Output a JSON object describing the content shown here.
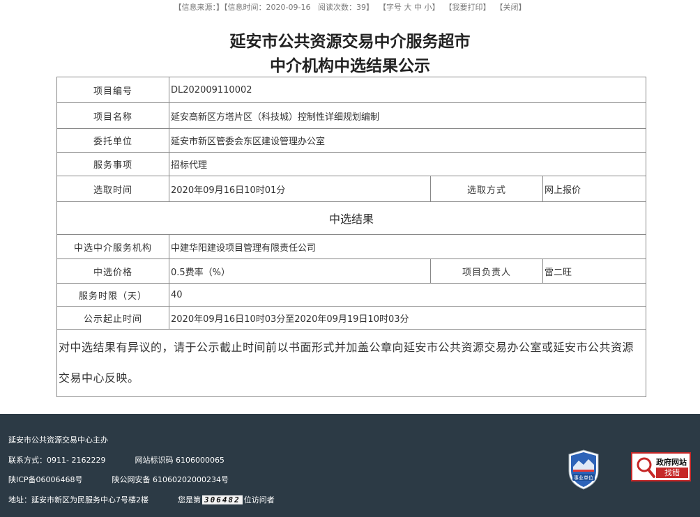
{
  "topbar": {
    "source_label": "【信息来源：】",
    "time_label": "【信息时间：2020-09-16",
    "views_label": "阅读次数：",
    "views_count": "39",
    "views_close": "】",
    "font_prefix": "【字号",
    "font_large": "大",
    "font_medium": "中",
    "font_small": "小",
    "font_close": "】",
    "print_label": "【我要打印】",
    "close_label": "【关闭】"
  },
  "page": {
    "title_line1": "延安市公共资源交易中介服务超市",
    "title_line2": "中介机构中选结果公示"
  },
  "info": {
    "project_no_label": "项目编号",
    "project_no": "DL202009110002",
    "project_name_label": "项目名称",
    "project_name": "延安高新区方塔片区（科技城）控制性详细规划编制",
    "client_label": "委托单位",
    "client": "延安市新区管委会东区建设管理办公室",
    "service_label": "服务事项",
    "service": "招标代理",
    "select_time_label": "选取时间",
    "select_time": "2020年09月16日10时01分",
    "select_method_label": "选取方式",
    "select_method": "网上报价"
  },
  "result": {
    "section_title": "中选结果",
    "agency_label": "中选中介服务机构",
    "agency": "中建华阳建设项目管理有限责任公司",
    "price_label": "中选价格",
    "price": "0.5费率（%）",
    "manager_label": "项目负责人",
    "manager": "雷二旺",
    "duration_label": "服务时限（天）",
    "duration": "40",
    "period_label": "公示起止时间",
    "period": "2020年09月16日10时03分至2020年09月19日10时03分",
    "note": "对中选结果有异议的，请于公示截止时间前以书面形式并加盖公章向延安市公共资源交易办公室或延安市公共资源交易中心反映。"
  },
  "footer": {
    "host": "延安市公共资源交易中心主办",
    "contact": "联系方式：0911- 2162229",
    "site_id": "网站标识码 6106000065",
    "icp": "陕ICP备06006468号",
    "police": "陕公网安备 61060202000234号",
    "address": "地址：延安市新区为民服务中心7号楼2楼",
    "visitor_prefix": "您是第",
    "visitor_count": "306482",
    "visitor_suffix": "位访问者",
    "badge_text": "事业单位",
    "gov_link_line1": "政府网站",
    "gov_link_line2": "找错"
  }
}
